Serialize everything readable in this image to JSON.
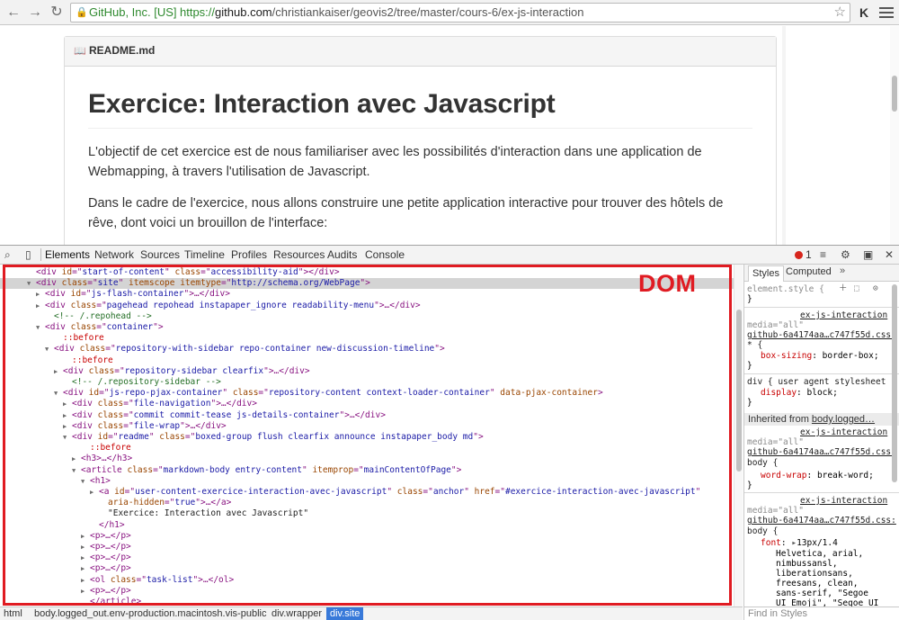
{
  "browser": {
    "ev_name": "GitHub, Inc. [US]",
    "url_proto": "https://",
    "url_host": "github.com",
    "url_path": "/christiankaiser/geovis2/tree/master/cours-6/ex-js-interaction"
  },
  "readme": {
    "filename": "README.md",
    "title": "Exercice: Interaction avec Javascript",
    "paragraph1": "L'objectif de cet exercice est de nous familiariser avec les possibilités d'interaction dans une application de Webmapping, à travers l'utilisation de Javascript.",
    "paragraph2": "Dans le cadre de l'exercice, nous allons construire une petite application interactive pour trouver des hôtels de rêve, dont voici un brouillon de l'interface:"
  },
  "devtools": {
    "tabs": [
      "Elements",
      "Network",
      "Sources",
      "Timeline",
      "Profiles",
      "Resources",
      "Audits",
      "Console"
    ],
    "active_tab": "Elements",
    "error_count": "1",
    "dom_annotation": "DOM",
    "dom_lines": [
      {
        "indent": 4,
        "tri": "",
        "parts": [
          [
            "tg",
            "<div "
          ],
          [
            "at",
            "id"
          ],
          [
            "tg",
            "=\""
          ],
          [
            "av",
            "start-of-content"
          ],
          [
            "tg",
            "\" "
          ],
          [
            "at",
            "class"
          ],
          [
            "tg",
            "=\""
          ],
          [
            "av",
            "accessibility-aid"
          ],
          [
            "tg",
            "\"></div>"
          ]
        ]
      },
      {
        "indent": 4,
        "tri": "▼",
        "sel": true,
        "parts": [
          [
            "tg",
            "<div "
          ],
          [
            "at",
            "class"
          ],
          [
            "tg",
            "=\""
          ],
          [
            "av",
            "site"
          ],
          [
            "tg",
            "\" "
          ],
          [
            "at",
            "itemscope itemtype"
          ],
          [
            "tg",
            "=\""
          ],
          [
            "av",
            "http://schema.org/WebPage"
          ],
          [
            "tg",
            "\">"
          ]
        ]
      },
      {
        "indent": 5,
        "tri": "▶",
        "parts": [
          [
            "tg",
            "<div "
          ],
          [
            "at",
            "id"
          ],
          [
            "tg",
            "=\""
          ],
          [
            "av",
            "js-flash-container"
          ],
          [
            "tg",
            "\">…</div>"
          ]
        ]
      },
      {
        "indent": 5,
        "tri": "▶",
        "parts": [
          [
            "tg",
            "<div "
          ],
          [
            "at",
            "class"
          ],
          [
            "tg",
            "=\""
          ],
          [
            "av",
            "pagehead repohead instapaper_ignore readability-menu"
          ],
          [
            "tg",
            "\">…</div>"
          ]
        ]
      },
      {
        "indent": 6,
        "tri": "",
        "parts": [
          [
            "cm",
            "<!-- /.repohead -->"
          ]
        ]
      },
      {
        "indent": 5,
        "tri": "▼",
        "parts": [
          [
            "tg",
            "<div "
          ],
          [
            "at",
            "class"
          ],
          [
            "tg",
            "=\""
          ],
          [
            "av",
            "container"
          ],
          [
            "tg",
            "\">"
          ]
        ]
      },
      {
        "indent": 7,
        "tri": "",
        "parts": [
          [
            "ps",
            "::before"
          ]
        ]
      },
      {
        "indent": 6,
        "tri": "▼",
        "parts": [
          [
            "tg",
            "<div "
          ],
          [
            "at",
            "class"
          ],
          [
            "tg",
            "=\""
          ],
          [
            "av",
            "repository-with-sidebar repo-container new-discussion-timeline"
          ],
          [
            "tg",
            "\">"
          ]
        ]
      },
      {
        "indent": 8,
        "tri": "",
        "parts": [
          [
            "ps",
            "::before"
          ]
        ]
      },
      {
        "indent": 7,
        "tri": "▶",
        "parts": [
          [
            "tg",
            "<div "
          ],
          [
            "at",
            "class"
          ],
          [
            "tg",
            "=\""
          ],
          [
            "av",
            "repository-sidebar clearfix"
          ],
          [
            "tg",
            "\">…</div>"
          ]
        ]
      },
      {
        "indent": 8,
        "tri": "",
        "parts": [
          [
            "cm",
            "<!-- /.repository-sidebar -->"
          ]
        ]
      },
      {
        "indent": 7,
        "tri": "▼",
        "parts": [
          [
            "tg",
            "<div "
          ],
          [
            "at",
            "id"
          ],
          [
            "tg",
            "=\""
          ],
          [
            "av",
            "js-repo-pjax-container"
          ],
          [
            "tg",
            "\" "
          ],
          [
            "at",
            "class"
          ],
          [
            "tg",
            "=\""
          ],
          [
            "av",
            "repository-content context-loader-container"
          ],
          [
            "tg",
            "\" "
          ],
          [
            "at",
            "data-pjax-container"
          ],
          [
            "tg",
            ">"
          ]
        ]
      },
      {
        "indent": 8,
        "tri": "▶",
        "parts": [
          [
            "tg",
            "<div "
          ],
          [
            "at",
            "class"
          ],
          [
            "tg",
            "=\""
          ],
          [
            "av",
            "file-navigation"
          ],
          [
            "tg",
            "\">…</div>"
          ]
        ]
      },
      {
        "indent": 8,
        "tri": "▶",
        "parts": [
          [
            "tg",
            "<div "
          ],
          [
            "at",
            "class"
          ],
          [
            "tg",
            "=\""
          ],
          [
            "av",
            "commit commit-tease js-details-container"
          ],
          [
            "tg",
            "\">…</div>"
          ]
        ]
      },
      {
        "indent": 8,
        "tri": "▶",
        "parts": [
          [
            "tg",
            "<div "
          ],
          [
            "at",
            "class"
          ],
          [
            "tg",
            "=\""
          ],
          [
            "av",
            "file-wrap"
          ],
          [
            "tg",
            "\">…</div>"
          ]
        ]
      },
      {
        "indent": 8,
        "tri": "▼",
        "parts": [
          [
            "tg",
            "<div "
          ],
          [
            "at",
            "id"
          ],
          [
            "tg",
            "=\""
          ],
          [
            "av",
            "readme"
          ],
          [
            "tg",
            "\" "
          ],
          [
            "at",
            "class"
          ],
          [
            "tg",
            "=\""
          ],
          [
            "av",
            "boxed-group flush clearfix announce instapaper_body md"
          ],
          [
            "tg",
            "\">"
          ]
        ]
      },
      {
        "indent": 10,
        "tri": "",
        "parts": [
          [
            "ps",
            "::before"
          ]
        ]
      },
      {
        "indent": 9,
        "tri": "▶",
        "parts": [
          [
            "tg",
            "<h3>…</h3>"
          ]
        ]
      },
      {
        "indent": 9,
        "tri": "▼",
        "parts": [
          [
            "tg",
            "<article "
          ],
          [
            "at",
            "class"
          ],
          [
            "tg",
            "=\""
          ],
          [
            "av",
            "markdown-body entry-content"
          ],
          [
            "tg",
            "\" "
          ],
          [
            "at",
            "itemprop"
          ],
          [
            "tg",
            "=\""
          ],
          [
            "av",
            "mainContentOfPage"
          ],
          [
            "tg",
            "\">"
          ]
        ]
      },
      {
        "indent": 10,
        "tri": "▼",
        "parts": [
          [
            "tg",
            "<h1>"
          ]
        ]
      },
      {
        "indent": 11,
        "tri": "▶",
        "parts": [
          [
            "tg",
            "<a "
          ],
          [
            "at",
            "id"
          ],
          [
            "tg",
            "=\""
          ],
          [
            "av",
            "user-content-exercice-interaction-avec-javascript"
          ],
          [
            "tg",
            "\" "
          ],
          [
            "at",
            "class"
          ],
          [
            "tg",
            "=\""
          ],
          [
            "av",
            "anchor"
          ],
          [
            "tg",
            "\" "
          ],
          [
            "at",
            "href"
          ],
          [
            "tg",
            "=\""
          ],
          [
            "av",
            "#exercice-interaction-avec-javascript"
          ],
          [
            "tg",
            "\""
          ]
        ]
      },
      {
        "indent": 12,
        "tri": "",
        "parts": [
          [
            "at",
            "aria-hidden"
          ],
          [
            "tg",
            "=\""
          ],
          [
            "av",
            "true"
          ],
          [
            "tg",
            "\">…</a>"
          ]
        ]
      },
      {
        "indent": 12,
        "tri": "",
        "parts": [
          [
            "txt",
            "\"Exercice: Interaction avec Javascript\""
          ]
        ]
      },
      {
        "indent": 11,
        "tri": "",
        "parts": [
          [
            "tg",
            "</h1>"
          ]
        ]
      },
      {
        "indent": 10,
        "tri": "▶",
        "parts": [
          [
            "tg",
            "<p>…</p>"
          ]
        ]
      },
      {
        "indent": 10,
        "tri": "▶",
        "parts": [
          [
            "tg",
            "<p>…</p>"
          ]
        ]
      },
      {
        "indent": 10,
        "tri": "▶",
        "parts": [
          [
            "tg",
            "<p>…</p>"
          ]
        ]
      },
      {
        "indent": 10,
        "tri": "▶",
        "parts": [
          [
            "tg",
            "<p>…</p>"
          ]
        ]
      },
      {
        "indent": 10,
        "tri": "▶",
        "parts": [
          [
            "tg",
            "<ol "
          ],
          [
            "at",
            "class"
          ],
          [
            "tg",
            "=\""
          ],
          [
            "av",
            "task-list"
          ],
          [
            "tg",
            "\">…</ol>"
          ]
        ]
      },
      {
        "indent": 10,
        "tri": "▶",
        "parts": [
          [
            "tg",
            "<p>…</p>"
          ]
        ]
      },
      {
        "indent": 10,
        "tri": "",
        "parts": [
          [
            "tg",
            "</article>"
          ]
        ]
      }
    ]
  },
  "styles": {
    "tab_styles": "Styles",
    "tab_computed": "Computed",
    "more": "»",
    "element_style": "element.style {",
    "close_brace": "}",
    "source_1": "ex-js-interaction",
    "media_1": "media=\"all\"",
    "file_1": "github-6a4174aa…c747f55d.css:",
    "star_rule": "* {",
    "prop_1": "box-sizing",
    "val_1": "border-box;",
    "ua_rule": "div { user agent stylesheet",
    "prop_2": "display",
    "val_2": "block;",
    "inherited_label": "Inherited from ",
    "inherited_link": "body.logged…",
    "source_2": "ex-js-interaction",
    "media_2": "media=\"all\"",
    "file_2": "github-6a4174aa…c747f55d.css:",
    "body_rule": "body {",
    "prop_3": "word-wrap",
    "val_3": "break-word;",
    "source_3": "ex-js-interaction",
    "media_3": "media=\"all\"",
    "file_3": "github-6a4174aa…c747f55d.css:",
    "body_rule_2": "body {",
    "prop_4": "font",
    "val_4": "13px/1.4",
    "font_list": [
      "Helvetica, arial,",
      "nimbussansl,",
      "liberationsans,",
      "freesans, clean,",
      "sans-serif, \"Segoe",
      "UI Emoji\", \"Segoe UI"
    ],
    "find_placeholder": "Find in Styles"
  },
  "breadcrumbs": [
    "html",
    "body.logged_out.env-production.macintosh.vis-public",
    "div.wrapper",
    "div.site"
  ]
}
